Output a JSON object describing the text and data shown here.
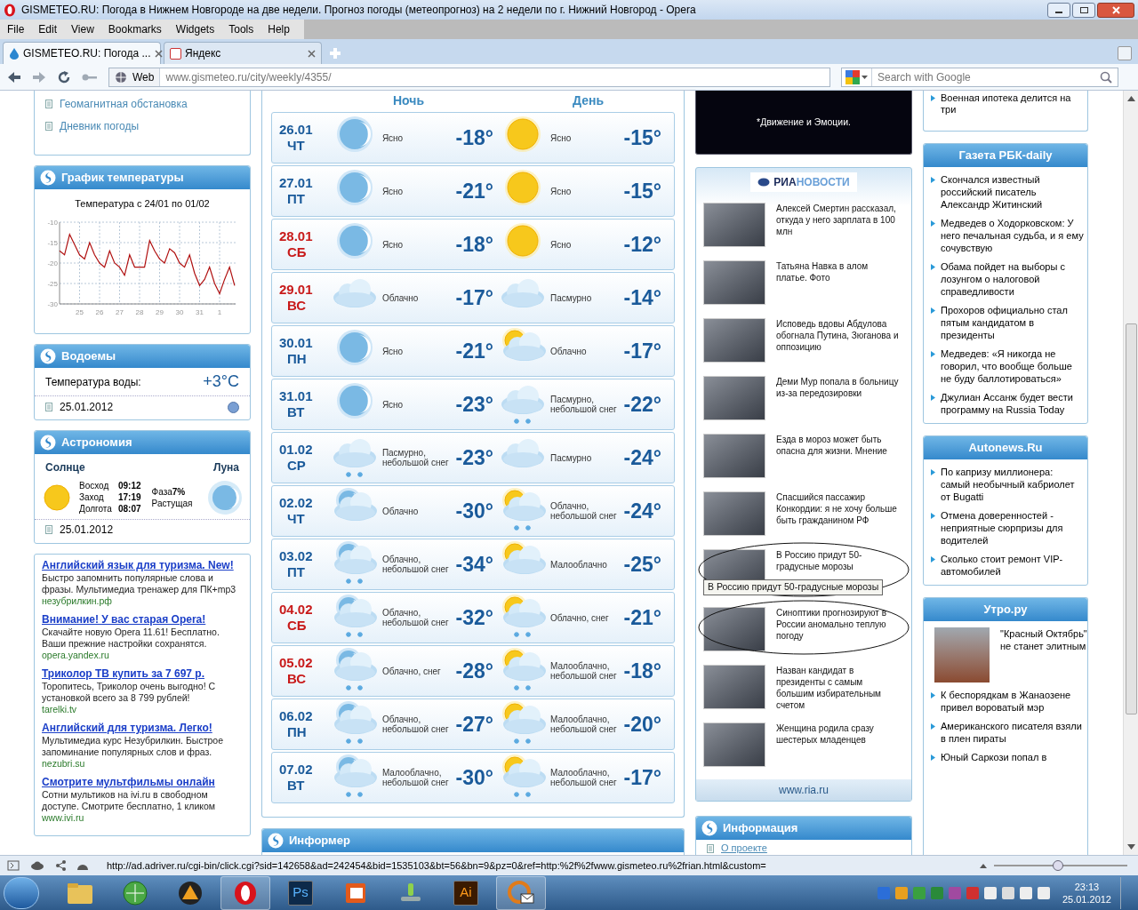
{
  "window": {
    "title": "GISMETEO.RU: Погода в Нижнем Новгороде на две недели. Прогноз погоды (метеопрогноз) на 2 недели по г. Нижний Новгород - Opera"
  },
  "menu": [
    "File",
    "Edit",
    "View",
    "Bookmarks",
    "Widgets",
    "Tools",
    "Help"
  ],
  "tabs": [
    {
      "label": "GISMETEO.RU: Погода ...",
      "selected": true
    },
    {
      "label": "Яндекс",
      "selected": false
    }
  ],
  "address_bar": {
    "mode": "Web",
    "url_host": "www.gismeteo.ru",
    "url_path": "/city/weekly/4355/"
  },
  "search": {
    "placeholder": "Search with Google"
  },
  "left": {
    "links": [
      "Геомагнитная обстановка",
      "Дневник погоды"
    ],
    "chart_panel": {
      "title": "График температуры",
      "subtitle": "Температура с 24/01 по 01/02",
      "chart_data": {
        "type": "line",
        "categories": [
          null,
          null,
          null,
          null,
          "25",
          null,
          null,
          null,
          "26",
          null,
          null,
          null,
          "27",
          null,
          null,
          null,
          "28",
          null,
          null,
          null,
          "29",
          null,
          null,
          null,
          "30",
          null,
          null,
          null,
          "31",
          null,
          null,
          null,
          "1",
          null,
          null,
          null
        ],
        "series": [
          {
            "color": "#b01010",
            "values": [
              -17,
              -18,
              -13,
              -15.5,
              -18,
              -19,
              -15,
              -18,
              -20,
              -21,
              -17,
              -20,
              -21,
              -23,
              -18,
              -21,
              -21,
              -21,
              -14.5,
              -17,
              -19,
              -20,
              -16.5,
              -17.5,
              -20,
              -21,
              -18,
              -22.5,
              -25.5,
              -24,
              -21,
              -25,
              -27.5,
              -24,
              -21,
              -25.5
            ]
          }
        ],
        "grid": true,
        "ylim": [
          -30,
          -10
        ],
        "yticks": [
          -10,
          -15,
          -20,
          -25,
          -30
        ]
      }
    },
    "water": {
      "title": "Водоемы",
      "label": "Температура воды:",
      "value": "+3°C",
      "date": "25.01.2012"
    },
    "astronomy": {
      "title": "Астрономия",
      "sun_label": "Солнце",
      "moon_label": "Луна",
      "sun_rows": [
        {
          "label": "Восход",
          "value": "09:12"
        },
        {
          "label": "Заход",
          "value": "17:19"
        },
        {
          "label": "Долгота",
          "value": "08:07"
        }
      ],
      "phase_label": "Фаза",
      "phase_value": "7%",
      "phase_name": "Растущая",
      "date": "25.01.2012"
    },
    "ads": [
      {
        "title": "Английский язык для туризма. New!",
        "text": "Быстро запомнить популярные слова и фразы. Мультимедиа тренажер для ПК+mp3",
        "url": "незубрилкин.рф"
      },
      {
        "title": "Внимание! У вас старая Opera!",
        "text": "Скачайте новую Opera 11.61! Бесплатно. Ваши прежние настройки сохранятся.",
        "url": "opera.yandex.ru"
      },
      {
        "title": "Триколор ТВ купить за 7 697 р.",
        "text": "Торопитесь, Триколор очень выгодно! С установкой всего за 8 799 рублей!",
        "url": "tarelki.tv"
      },
      {
        "title": "Английский для туризма. Легко!",
        "text": "Мультимедиа курс Незубрилкин. Быстрое запоминание популярных слов и фраз.",
        "url": "nezubri.su"
      },
      {
        "title": "Смотрите мультфильмы онлайн",
        "text": "Сотни мультиков на ivi.ru в свободном доступе. Смотрите бесплатно, 1 кликом",
        "url": "www.ivi.ru"
      }
    ]
  },
  "forecast": {
    "night_label": "Ночь",
    "day_label": "День",
    "rows": [
      {
        "date": "26.01",
        "weekday": "ЧТ",
        "weekend": false,
        "night": {
          "kind": "moon",
          "snow": false,
          "text": "Ясно",
          "temp": "-18°"
        },
        "day": {
          "kind": "sun",
          "snow": false,
          "text": "Ясно",
          "temp": "-15°"
        }
      },
      {
        "date": "27.01",
        "weekday": "ПТ",
        "weekend": false,
        "night": {
          "kind": "moon",
          "snow": false,
          "text": "Ясно",
          "temp": "-21°"
        },
        "day": {
          "kind": "sun",
          "snow": false,
          "text": "Ясно",
          "temp": "-15°"
        }
      },
      {
        "date": "28.01",
        "weekday": "СБ",
        "weekend": true,
        "night": {
          "kind": "moon",
          "snow": false,
          "text": "Ясно",
          "temp": "-18°"
        },
        "day": {
          "kind": "sun",
          "snow": false,
          "text": "Ясно",
          "temp": "-12°"
        }
      },
      {
        "date": "29.01",
        "weekday": "ВС",
        "weekend": true,
        "night": {
          "kind": "cloud",
          "snow": false,
          "text": "Облачно",
          "temp": "-17°"
        },
        "day": {
          "kind": "cloud",
          "snow": false,
          "text": "Пасмурно",
          "temp": "-14°"
        }
      },
      {
        "date": "30.01",
        "weekday": "ПН",
        "weekend": false,
        "night": {
          "kind": "moon",
          "snow": false,
          "text": "Ясно",
          "temp": "-21°"
        },
        "day": {
          "kind": "sun-cloud",
          "snow": false,
          "text": "Облачно",
          "temp": "-17°"
        }
      },
      {
        "date": "31.01",
        "weekday": "ВТ",
        "weekend": false,
        "night": {
          "kind": "moon",
          "snow": false,
          "text": "Ясно",
          "temp": "-23°"
        },
        "day": {
          "kind": "cloud",
          "snow": true,
          "text": "Пасмурно, небольшой снег",
          "temp": "-22°"
        }
      },
      {
        "date": "01.02",
        "weekday": "СР",
        "weekend": false,
        "night": {
          "kind": "cloud",
          "snow": true,
          "text": "Пасмурно, небольшой снег",
          "temp": "-23°"
        },
        "day": {
          "kind": "cloud",
          "snow": false,
          "text": "Пасмурно",
          "temp": "-24°"
        }
      },
      {
        "date": "02.02",
        "weekday": "ЧТ",
        "weekend": false,
        "night": {
          "kind": "moon-cloud",
          "snow": false,
          "text": "Облачно",
          "temp": "-30°"
        },
        "day": {
          "kind": "sun-cloud",
          "snow": true,
          "text": "Облачно, небольшой снег",
          "temp": "-24°"
        }
      },
      {
        "date": "03.02",
        "weekday": "ПТ",
        "weekend": false,
        "night": {
          "kind": "moon-cloud",
          "snow": true,
          "text": "Облачно, небольшой снег",
          "temp": "-34°"
        },
        "day": {
          "kind": "sun-cloud",
          "snow": false,
          "text": "Малооблачно",
          "temp": "-25°"
        }
      },
      {
        "date": "04.02",
        "weekday": "СБ",
        "weekend": true,
        "night": {
          "kind": "moon-cloud",
          "snow": true,
          "text": "Облачно, небольшой снег",
          "temp": "-32°"
        },
        "day": {
          "kind": "sun-cloud",
          "snow": true,
          "text": "Облачно, снег",
          "temp": "-21°"
        }
      },
      {
        "date": "05.02",
        "weekday": "ВС",
        "weekend": true,
        "night": {
          "kind": "moon-cloud",
          "snow": true,
          "text": "Облачно, снег",
          "temp": "-28°"
        },
        "day": {
          "kind": "sun-cloud",
          "snow": true,
          "text": "Малооблачно, небольшой снег",
          "temp": "-18°"
        }
      },
      {
        "date": "06.02",
        "weekday": "ПН",
        "weekend": false,
        "night": {
          "kind": "moon-cloud",
          "snow": true,
          "text": "Облачно, небольшой снег",
          "temp": "-27°"
        },
        "day": {
          "kind": "sun-cloud",
          "snow": true,
          "text": "Малооблачно, небольшой снег",
          "temp": "-20°"
        }
      },
      {
        "date": "07.02",
        "weekday": "ВТ",
        "weekend": false,
        "night": {
          "kind": "moon-cloud",
          "snow": true,
          "text": "Малооблачно, небольшой снег",
          "temp": "-30°"
        },
        "day": {
          "kind": "sun-cloud",
          "snow": true,
          "text": "Малооблачно, небольшой снег",
          "temp": "-17°"
        }
      }
    ]
  },
  "informer": {
    "title": "Информер"
  },
  "ad_banner": {
    "text": "*Движение и Эмоции."
  },
  "ria_news": {
    "logo_prefix": "РИА",
    "logo_suffix": "НОВОСТИ",
    "items": [
      {
        "text": "Алексей Смертин рассказал, откуда у него зарплата в 100 млн",
        "circled": false
      },
      {
        "text": "Татьяна Навка в алом платье. Фото",
        "circled": false
      },
      {
        "text": "Исповедь вдовы Абдулова обогнала Путина, Зюганова и оппозицию",
        "circled": false
      },
      {
        "text": "Деми Мур попала в больницу из-за передозировки",
        "circled": false
      },
      {
        "text": "Езда в мороз может быть опасна для жизни. Мнение",
        "circled": false
      },
      {
        "text": "Спасшийся пассажир Конкордии: я не хочу больше быть гражданином РФ",
        "circled": false
      },
      {
        "text": "В Россию придут 50-градусные морозы",
        "circled": true
      },
      {
        "text": "Синоптики прогнозируют в России аномально теплую погоду",
        "circled": true
      },
      {
        "text": "Назван кандидат в президенты с самым большим избирательным счетом",
        "circled": false
      },
      {
        "text": "Женщина родила сразу шестерых младенцев",
        "circled": false
      }
    ],
    "tooltip": "В Россию придут 50-градусные морозы",
    "footer": "www.ria.ru"
  },
  "info": {
    "title": "Информация",
    "links": [
      "О проекте"
    ]
  },
  "right": {
    "top_items": [
      "Военная ипотека делится на три"
    ],
    "sections": [
      {
        "title": "Газета РБК-daily",
        "items": [
          "Скончался известный российский писатель Александр Житинский",
          "Медведев о Ходорковском: У него печальная судьба, и я ему сочувствую",
          "Обама пойдет на выборы с лозунгом о налоговой справедливости",
          "Прохоров официально стал пятым кандидатом в президенты",
          "Медведев: «Я никогда не говорил, что вообще больше не буду баллотироваться»",
          "Джулиан Ассанж будет вести программу на Russia Today"
        ]
      },
      {
        "title": "Autonews.Ru",
        "items": [
          "По капризу миллионера: самый необычный кабриолет от Bugatti",
          "Отмена доверенностей - неприятные сюрпризы для водителей",
          "Сколько стоит ремонт VIP-автомобилей"
        ]
      },
      {
        "title": "Утро.ру",
        "feature": "\"Красный Октябрь\" не станет элитным",
        "items": [
          "К беспорядкам в Жанаозене привел вороватый мэр",
          "Американского писателя взяли в плен пираты",
          "Юный Саркози попал в"
        ]
      }
    ]
  },
  "status_bar": {
    "url": "http://ad.adriver.ru/cgi-bin/click.cgi?sid=142658&ad=242454&bid=1535103&bt=56&bn=9&pz=0&ref=http:%2f%2fwww.gismeteo.ru%2frian.html&custom=",
    "zoom": {
      "level": 0.48
    }
  },
  "taskbar": {
    "apps": [
      {
        "kind": "folder",
        "active": false
      },
      {
        "kind": "globe",
        "active": false
      },
      {
        "kind": "triangle",
        "active": false
      },
      {
        "kind": "opera",
        "active": true
      },
      {
        "kind": "ps",
        "label": "Ps",
        "active": false
      },
      {
        "kind": "doc",
        "active": false
      },
      {
        "kind": "figure",
        "active": false
      },
      {
        "kind": "ai",
        "label": "Ai",
        "active": false
      },
      {
        "kind": "mail",
        "active": true
      }
    ],
    "time": "23:13",
    "date": "25.01.2012"
  }
}
